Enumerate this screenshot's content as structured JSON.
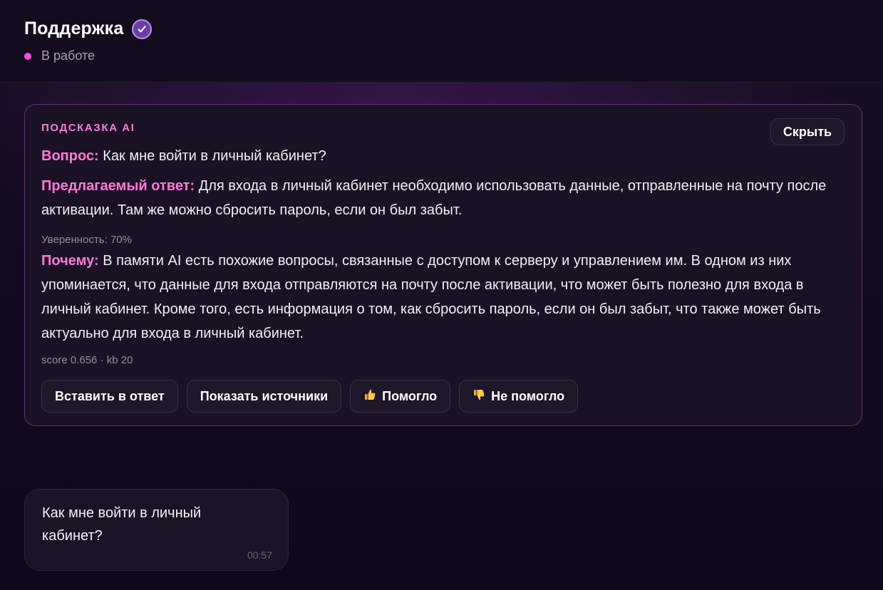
{
  "header": {
    "title": "Поддержка",
    "verified_icon": "check-badge-icon",
    "status": "В работе",
    "status_color": "#ff4fd8"
  },
  "ai_hint": {
    "label": "ПОДСКАЗКА AI",
    "hide_button": "Скрыть",
    "question_label": "Вопрос:",
    "question_text": "Как мне войти в личный кабинет?",
    "answer_label": "Предлагаемый ответ:",
    "answer_text": "Для входа в личный кабинет необходимо использовать данные, отправленные на почту после активации. Там же можно сбросить пароль, если он был забыт.",
    "confidence": "Уверенность: 70%",
    "why_label": "Почему:",
    "why_text": "В памяти AI есть похожие вопросы, связанные с доступом к серверу и управлением им. В одном из них упоминается, что данные для входа отправляются на почту после активации, что может быть полезно для входа в личный кабинет. Кроме того, есть информация о том, как сбросить пароль, если он был забыт, что также может быть актуально для входа в личный кабинет.",
    "meta": "score 0.656 · kb 20",
    "actions": {
      "insert": "Вставить в ответ",
      "sources": "Показать источники",
      "helped": "Помогло",
      "helped_icon": "thumbs-up-icon",
      "not_helped": "Не помогло",
      "not_helped_icon": "thumbs-down-icon"
    }
  },
  "message": {
    "text": "Как мне войти в личный кабинет?",
    "time": "00:57"
  },
  "colors": {
    "accent": "#ff7ad9",
    "card_border": "#6d2d7a",
    "background": "#120a1a"
  }
}
